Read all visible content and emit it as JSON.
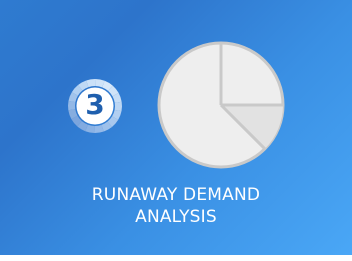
{
  "tile": {
    "step_number": "3",
    "title_line1": "RUNAWAY DEMAND",
    "title_line2": "ANALYSIS",
    "icon": "pie-chart-icon",
    "badge_icon": "step-ring-icon",
    "colors": {
      "background_start": "#2f7bd0",
      "background_end": "#4aa7f6",
      "pie_fill": "#eeeeee",
      "pie_outline": "#c9c9c9",
      "text": "#ffffff",
      "number": "#1f5fae"
    }
  }
}
